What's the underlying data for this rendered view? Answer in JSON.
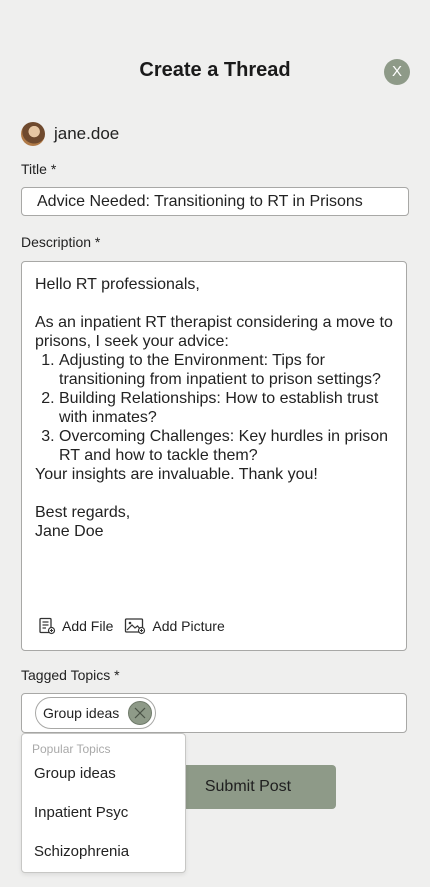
{
  "header": {
    "title": "Create a Thread",
    "close_label": "X"
  },
  "user": {
    "username": "jane.doe"
  },
  "form": {
    "title_label": "Title *",
    "title_value": "Advice Needed: Transitioning to RT in Prisons",
    "description_label": "Description *",
    "description": {
      "greeting": "Hello RT professionals,",
      "intro": "As an inpatient RT therapist considering a move to prisons, I seek your advice:",
      "items": [
        "Adjusting to the Environment: Tips for transitioning from inpatient to prison settings?",
        "Building Relationships: How to establish trust with inmates?",
        "Overcoming Challenges: Key hurdles in prison RT and how to tackle them?"
      ],
      "thanks": "Your insights are invaluable. Thank you!",
      "closing": "Best regards,",
      "signature": "Jane Doe"
    },
    "add_file_label": "Add File",
    "add_picture_label": "Add Picture",
    "tags_label": "Tagged Topics *",
    "selected_tags": [
      "Group ideas"
    ],
    "submit_label": "Submit Post"
  },
  "dropdown": {
    "header": "Popular Topics",
    "options": [
      "Group ideas",
      "Inpatient Psyc",
      "Schizophrenia"
    ]
  },
  "colors": {
    "accent": "#8e9a88",
    "background": "#efefee",
    "border": "#a8a8a6"
  }
}
